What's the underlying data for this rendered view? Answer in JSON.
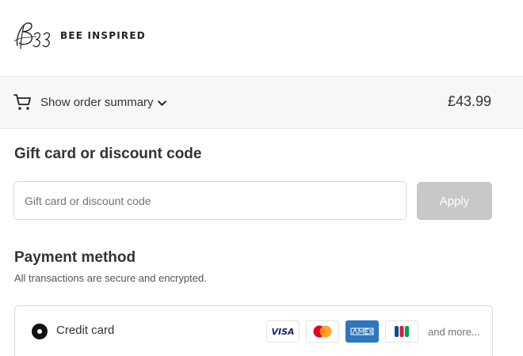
{
  "header": {
    "brand": "BEE INSPIRED",
    "logo_mark": "B33"
  },
  "summary": {
    "toggle_label": "Show order summary",
    "total": "£43.99"
  },
  "discount": {
    "title": "Gift card or discount code",
    "placeholder": "Gift card or discount code",
    "apply_label": "Apply"
  },
  "payment": {
    "title": "Payment method",
    "subtitle": "All transactions are secure and encrypted.",
    "method_label": "Credit card",
    "card_brands": [
      "visa-icon",
      "mastercard-icon",
      "amex-icon",
      "jcb-icon"
    ],
    "visa_text": "VISA",
    "more_text": "and more..."
  },
  "colors": {
    "apply_disabled": "#c8c8c8",
    "summary_bg": "#f7f7f7",
    "amex_blue": "#2e77bc",
    "mastercard_red": "#eb001b",
    "mastercard_orange": "#f79e1b"
  }
}
